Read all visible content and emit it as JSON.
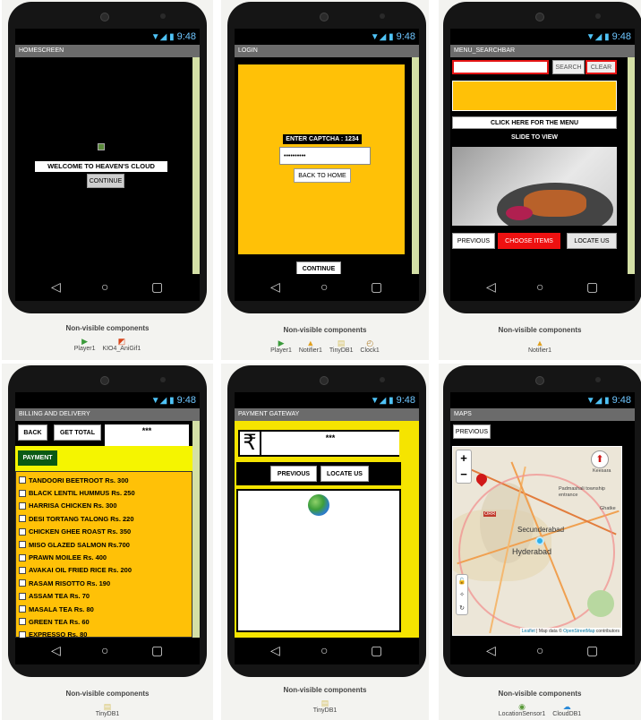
{
  "status_time": "9:48",
  "non_visible_label": "Non-visible components",
  "screens": {
    "home": {
      "title": "HOMESCREEN",
      "welcome": "WELCOME TO HEAVEN'S CLOUD",
      "continue": "CONTINUE",
      "components": [
        "Player1",
        "KIO4_AniGif1"
      ]
    },
    "login": {
      "title": "LOGIN",
      "captcha": "ENTER CAPTCHA : 1234",
      "password": "••••••••••",
      "back_home": "BACK TO HOME",
      "continue": "CONTINUE",
      "components": [
        "Player1",
        "Notifier1",
        "TinyDB1",
        "Clock1"
      ]
    },
    "menu": {
      "title": "MENU_SEARCHBAR",
      "search": "SEARCH",
      "clear": "CLEAR",
      "menu_button": "CLICK HERE FOR THE MENU",
      "slide": "SLIDE TO VIEW",
      "previous": "PREVIOUS",
      "choose": "CHOOSE ITEMS",
      "locate": "LOCATE US",
      "components": [
        "Notifier1"
      ]
    },
    "billing": {
      "title": "BILLING AND DELIVERY",
      "back": "BACK",
      "get_total": "GET TOTAL",
      "total_value": "***",
      "payment": "PAYMENT",
      "items": [
        "TANDOORI BEETROOT Rs. 300",
        "BLACK LENTIL HUMMUS Rs. 250",
        "HARRISA CHICKEN Rs. 300",
        "DESI TORTANG TALONG Rs. 220",
        "CHICKEN GHEE ROAST Rs. 350",
        "MISO GLAZED SALMON Rs.700",
        "PRAWN MOILEE Rs. 400",
        "AVAKAI OIL FRIED RICE Rs. 200",
        "RASAM RISOTTO Rs. 190",
        "ASSAM TEA Rs. 70",
        "MASALA TEA Rs. 80",
        "GREEN TEA Rs. 60",
        "EXPRESSO Rs. 80"
      ],
      "components": [
        "TinyDB1"
      ]
    },
    "payment": {
      "title": "PAYMENT GATEWAY",
      "rupee": "₹",
      "amount": "***",
      "previous": "PREVIOUS",
      "locate": "LOCATE US",
      "components": [
        "TinyDB1"
      ]
    },
    "maps": {
      "title": "MAPS",
      "previous": "PREVIOUS",
      "zoom_in": "+",
      "zoom_out": "−",
      "label_secunderabad": "Secunderabad",
      "label_hyderabad": "Hyderabad",
      "label_padmashali": "Padmashali township entrance",
      "label_keesara": "Keesara",
      "label_ghatkesar": "Ghatke",
      "label_orr": "ORR",
      "attribution_leaflet": "Leaflet",
      "attribution_rest": " | Map data © ",
      "attribution_osm": "OpenStreetMap",
      "attribution_end": " contributors",
      "components": [
        "LocationSensor1",
        "CloudDB1"
      ]
    }
  },
  "colors": {
    "accent_yellow": "#ffc107",
    "lime_yellow": "#f5f500",
    "red": "#ee1111",
    "green_button": "#0a5a14",
    "scrollbar": "#d4e0a6"
  }
}
